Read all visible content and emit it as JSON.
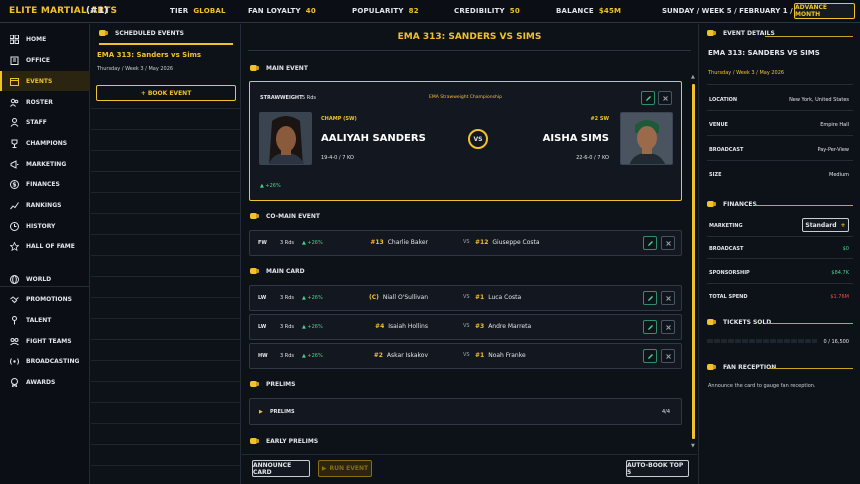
{
  "topbar": {
    "brand": "ELITE MARTIAL ARTS",
    "rank": "(#1)",
    "tier_label": "TIER",
    "tier_value": "GLOBAL",
    "loyalty_label": "FAN LOYALTY",
    "loyalty_value": "40",
    "popularity_label": "POPULARITY",
    "popularity_value": "82",
    "credibility_label": "CREDIBILITY",
    "credibility_value": "50",
    "balance_label": "BALANCE",
    "balance_value": "$45M",
    "date": "SUNDAY / WEEK 5 / FEBRUARY 1 / 2026",
    "advance": "ADVANCE MONTH"
  },
  "sidebar": {
    "items": [
      {
        "label": "HOME",
        "icon": "grid-icon"
      },
      {
        "label": "OFFICE",
        "icon": "building-icon"
      },
      {
        "label": "EVENTS",
        "icon": "calendar-icon"
      },
      {
        "label": "ROSTER",
        "icon": "users-icon"
      },
      {
        "label": "STAFF",
        "icon": "staff-icon"
      },
      {
        "label": "CHAMPIONS",
        "icon": "trophy-icon"
      },
      {
        "label": "MARKETING",
        "icon": "megaphone-icon"
      },
      {
        "label": "FINANCES",
        "icon": "dollar-icon"
      },
      {
        "label": "RANKINGS",
        "icon": "chart-icon"
      },
      {
        "label": "HISTORY",
        "icon": "clock-icon"
      },
      {
        "label": "HALL OF FAME",
        "icon": "star-icon"
      },
      {
        "label": "WORLD",
        "icon": "globe-icon"
      },
      {
        "label": "PROMOTIONS",
        "icon": "handshake-icon"
      },
      {
        "label": "TALENT",
        "icon": "person-icon"
      },
      {
        "label": "FIGHT TEAMS",
        "icon": "team-icon"
      },
      {
        "label": "BROADCASTING",
        "icon": "broadcast-icon"
      },
      {
        "label": "AWARDS",
        "icon": "award-icon"
      }
    ]
  },
  "scheduled": {
    "header": "SCHEDULED EVENTS",
    "event_name": "EMA 313: Sanders vs Sims",
    "event_date": "Thursday  /  Week 3  /  May 2026",
    "book_button": "+ BOOK EVENT"
  },
  "main": {
    "title": "EMA 313: SANDERS VS SIMS",
    "main_event_header": "MAIN EVENT",
    "main_event": {
      "weight": "STRAWWEIGHT",
      "rounds": "5 Rds",
      "championship": "EMA Strawweight Championship",
      "champ_tag": "CHAMP (SW)",
      "fighter1": "AALIYAH SANDERS",
      "record1": "19-4-0  /  7 KO",
      "vs": "VS",
      "rank_tag": "#2 SW",
      "fighter2": "AISHA SIMS",
      "record2": "22-6-0  /  7 KO",
      "hype": "▲ +26%"
    },
    "comain_header": "CO-MAIN EVENT",
    "comain": {
      "wc": "FW",
      "rds": "3 Rds",
      "hype": "▲ +26%",
      "seed1": "#13",
      "f1": "Charlie Baker",
      "vs": "VS",
      "seed2": "#12",
      "f2": "Giuseppe Costa"
    },
    "main_card_header": "MAIN CARD",
    "main_card": [
      {
        "wc": "LW",
        "rds": "3 Rds",
        "hype": "▲ +26%",
        "seed1": "(C)",
        "f1": "Niall O'Sullivan",
        "vs": "VS",
        "seed2": "#1",
        "f2": "Luca Costa"
      },
      {
        "wc": "LW",
        "rds": "3 Rds",
        "hype": "▲ +26%",
        "seed1": "#4",
        "f1": "Isaiah Hollins",
        "vs": "VS",
        "seed2": "#3",
        "f2": "Andre Marreta"
      },
      {
        "wc": "HW",
        "rds": "3 Rds",
        "hype": "▲ +26%",
        "seed1": "#2",
        "f1": "Askar Iskakov",
        "vs": "VS",
        "seed2": "#1",
        "f2": "Noah Franke"
      }
    ],
    "prelims_header": "PRELIMS",
    "prelims_row_label": "PRELIMS",
    "prelims_count": "4/4",
    "early_prelims_header": "EARLY PRELIMS",
    "announce_button": "ANNOUNCE CARD",
    "run_button": "RUN EVENT",
    "autobook_button": "AUTO-BOOK TOP 5"
  },
  "details": {
    "header": "EVENT DETAILS",
    "event_name": "EMA 313: SANDERS VS SIMS",
    "event_date": "Thursday  /  Week 3  /  May 2026",
    "location_label": "LOCATION",
    "location_value": "New York, United States",
    "venue_label": "VENUE",
    "venue_value": "Empire Hall",
    "broadcast_label": "BROADCAST",
    "broadcast_value": "Pay-Per-View",
    "size_label": "SIZE",
    "size_value": "Medium",
    "finances_header": "FINANCES",
    "marketing_label": "MARKETING",
    "marketing_value": "Standard",
    "fin_broadcast_label": "BROADCAST",
    "fin_broadcast_value": "$0",
    "sponsorship_label": "SPONSORSHIP",
    "sponsorship_value": "$84.7K",
    "total_spend_label": "TOTAL SPEND",
    "total_spend_value": "$1.76M",
    "tickets_header": "TICKETS SOLD",
    "tickets_value": "0 / 16,500",
    "tickets_fraction": 0,
    "reception_header": "FAN RECEPTION",
    "reception_text": "Announce the card to gauge fan reception."
  },
  "colors": {
    "accent": "#f2c22a",
    "background": "#0d1118",
    "positive": "#4bd28a",
    "negative": "#e0574f"
  }
}
